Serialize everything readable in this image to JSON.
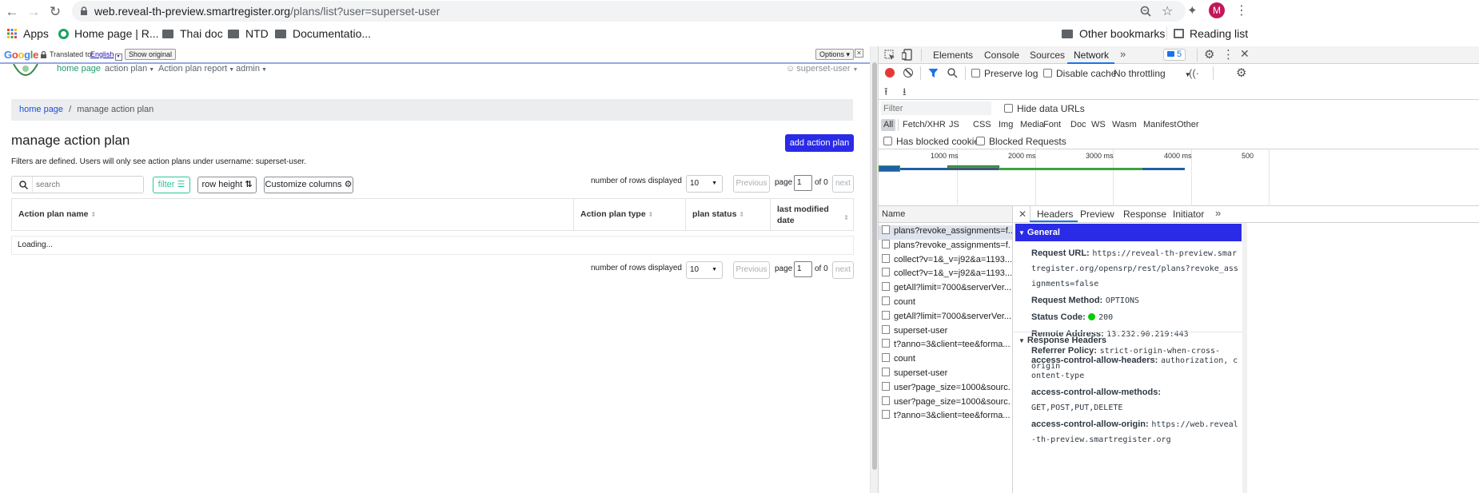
{
  "browser": {
    "url_domain": "web.reveal-th-preview.smartregister.org",
    "url_path": "/plans/list?user=superset-user",
    "profile_initial": "M",
    "bookmarks": [
      "Apps",
      "Home page | R...",
      "Thai doc",
      "NTD",
      "Documentatio..."
    ],
    "other_bookmarks": "Other bookmarks",
    "reading_list": "Reading list"
  },
  "translate": {
    "brand": "Google",
    "translated_to": "Translated to:",
    "language": "English",
    "show_original": "Show original",
    "options": "Options ▾",
    "close": "✕"
  },
  "app": {
    "nav": [
      "home page",
      "action plan",
      "Action plan report",
      "admin"
    ],
    "user": "superset-user",
    "breadcrumb": {
      "home": "home page",
      "separator": "/",
      "current": "manage action plan"
    },
    "title": "manage action plan",
    "add_button": "add action plan",
    "filter_note": "Filters are defined. Users will only see action plans under username: superset-user.",
    "search_placeholder": "search",
    "filter_button": "filter",
    "row_height_button": "row height",
    "customize_button": "Customize columns",
    "rows_label": "number of rows displayed",
    "rows_value": "10",
    "previous": "Previous",
    "page_label": "page",
    "page_value": "1",
    "of_label": "of 0",
    "next": "next",
    "columns": [
      "Action plan name",
      "Action plan type",
      "plan status",
      "last modified date"
    ],
    "loading": "Loading..."
  },
  "devtools": {
    "tabs": [
      "Elements",
      "Console",
      "Sources",
      "Network"
    ],
    "active_tab": "Network",
    "issues_count": "5",
    "preserve_log": "Preserve log",
    "disable_cache": "Disable cache",
    "throttling": "No throttling",
    "filter_placeholder": "Filter",
    "hide_data_urls": "Hide data URLs",
    "types": [
      "All",
      "Fetch/XHR",
      "JS",
      "CSS",
      "Img",
      "Media",
      "Font",
      "Doc",
      "WS",
      "Wasm",
      "Manifest",
      "Other"
    ],
    "has_blocked_cookies": "Has blocked cookies",
    "blocked_requests": "Blocked Requests",
    "timeline_ticks": [
      "1000 ms",
      "2000 ms",
      "3000 ms",
      "4000 ms",
      "500"
    ],
    "name_header": "Name",
    "requests": [
      "plans?revoke_assignments=f...",
      "plans?revoke_assignments=f...",
      "collect?v=1&_v=j92&a=1193...",
      "collect?v=1&_v=j92&a=1193...",
      "getAll?limit=7000&serverVer...",
      "count",
      "getAll?limit=7000&serverVer...",
      "superset-user",
      "t?anno=3&client=tee&forma...",
      "count",
      "superset-user",
      "user?page_size=1000&sourc...",
      "user?page_size=1000&sourc...",
      "t?anno=3&client=tee&forma..."
    ],
    "detail_tabs": [
      "Headers",
      "Preview",
      "Response",
      "Initiator"
    ],
    "general_title": "General",
    "general": [
      {
        "key": "Request URL:",
        "value": "https://reveal-th-preview.smartregister.org/opensrp/rest/plans?revoke_assignments=false"
      },
      {
        "key": "Request Method:",
        "value": "OPTIONS"
      },
      {
        "key": "Status Code:",
        "value": "200"
      },
      {
        "key": "Remote Address:",
        "value": "13.232.90.219:443"
      },
      {
        "key": "Referrer Policy:",
        "value": "strict-origin-when-cross-origin"
      }
    ],
    "response_headers_title": "Response Headers",
    "response_headers": [
      {
        "key": "access-control-allow-headers:",
        "value": "authorization, content-type"
      },
      {
        "key": "access-control-allow-methods:",
        "value": "GET,POST,PUT,DELETE"
      },
      {
        "key": "access-control-allow-origin:",
        "value": "https://web.reveal-th-preview.smartregister.org"
      }
    ]
  }
}
